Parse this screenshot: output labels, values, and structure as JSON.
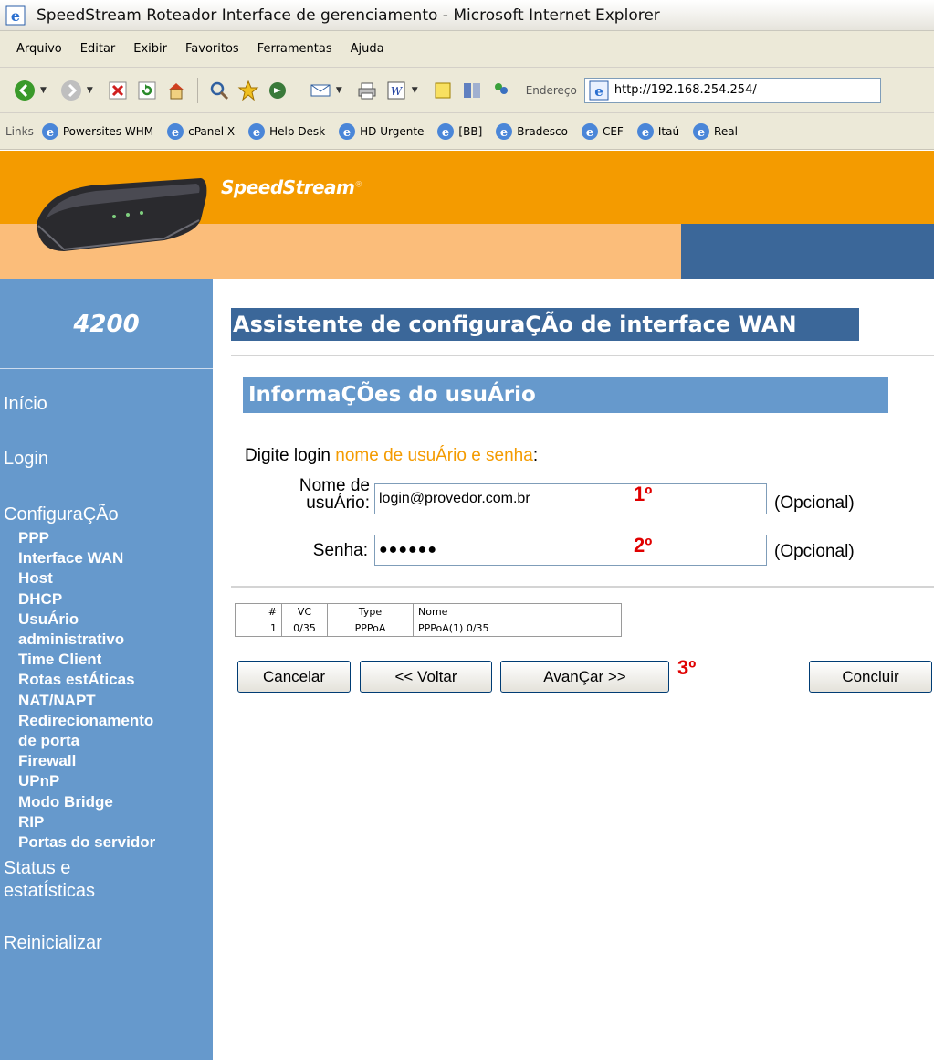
{
  "window": {
    "title": "SpeedStream Roteador Interface de gerenciamento - Microsoft Internet Explorer"
  },
  "menubar": [
    "Arquivo",
    "Editar",
    "Exibir",
    "Favoritos",
    "Ferramentas",
    "Ajuda"
  ],
  "address": {
    "label": "Endereço",
    "url": "http://192.168.254.254/"
  },
  "links": {
    "label": "Links",
    "items": [
      "Powersites-WHM",
      "cPanel X",
      "Help Desk",
      "HD Urgente",
      "[BB]",
      "Bradesco",
      "CEF",
      "Itaú",
      "Real"
    ]
  },
  "header": {
    "brand": "SpeedStream",
    "brand_mark": "®",
    "model": "4200"
  },
  "sidebar": {
    "inicio": "Início",
    "login": "Login",
    "configuracao": "ConfiguraÇÃo",
    "sub_items": [
      "PPP",
      "Interface WAN",
      "Host",
      "DHCP",
      "UsuÁrio",
      "administrativo",
      "Time Client",
      "Rotas estÁticas",
      "NAT/NAPT",
      "Redirecionamento",
      "de porta",
      "Firewall",
      "UPnP",
      "Modo Bridge",
      "RIP",
      "Portas do servidor"
    ],
    "status_line1": "Status e",
    "status_line2": "estatÍsticas",
    "reiniciar": "Reinicializar"
  },
  "main": {
    "title": "Assistente de configuraÇÃo de interface WAN",
    "section_title": "InformaÇÕes do usuÁrio",
    "prompt_prefix": "Digite login ",
    "prompt_highlight": "nome de usuÁrio e senha",
    "prompt_suffix": ":",
    "username_label_line1": "Nome de",
    "username_label_line2": "usuÁrio:",
    "username_value": "login@provedor.com.br",
    "password_label": "Senha:",
    "password_value": "●●●●●●",
    "optional_label": "(Opcional)",
    "annotation_1": "1º",
    "annotation_2": "2º",
    "annotation_3": "3º"
  },
  "vc_table": {
    "headers": [
      "#",
      "VC",
      "Type",
      "Nome"
    ],
    "rows": [
      [
        "1",
        "0/35",
        "PPPoA",
        "PPPoA(1) 0/35"
      ]
    ]
  },
  "buttons": {
    "cancel": "Cancelar",
    "back": "<< Voltar",
    "next": "AvanÇar >>",
    "finish": "Concluir"
  },
  "colors": {
    "orange": "#f49b00",
    "light_orange": "#fbbd7a",
    "blue_dark": "#3b6799",
    "blue_light": "#6699cc",
    "annotation_red": "#e00000"
  }
}
